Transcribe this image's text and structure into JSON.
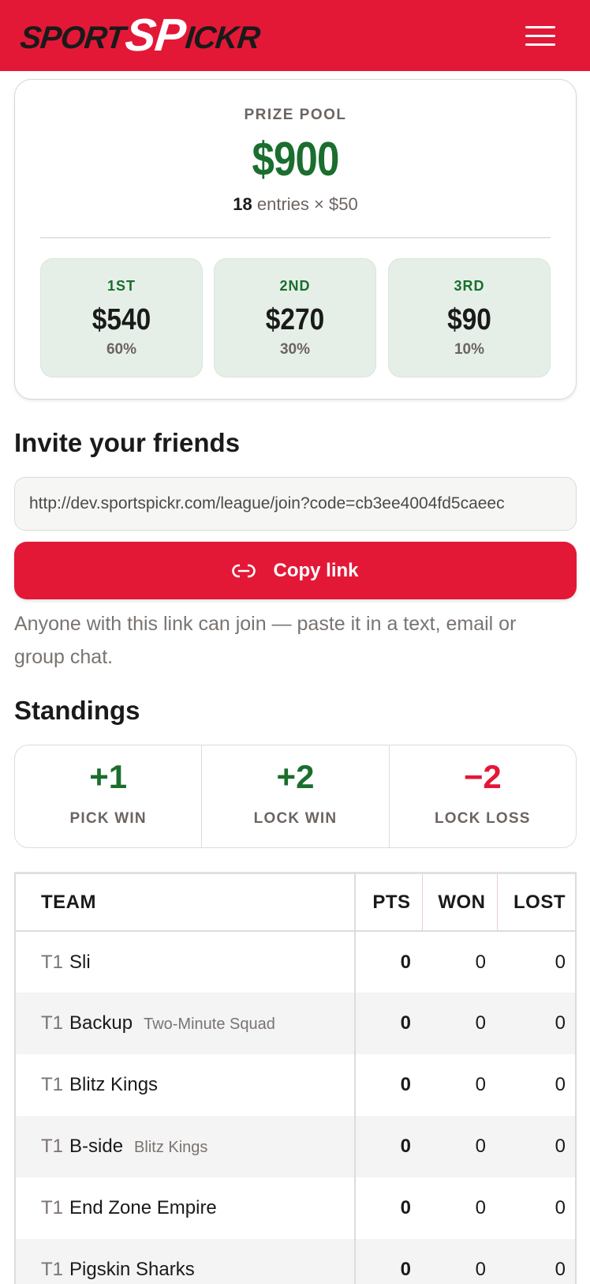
{
  "header": {
    "logo_part1": "SPORT",
    "logo_part2": "SP",
    "logo_part3": "ICKR",
    "menu_icon": "hamburger-menu-icon"
  },
  "prize_pool": {
    "label": "PRIZE POOL",
    "amount": "$900",
    "entries_count": "18",
    "entries_text": " entries × $50",
    "places": [
      {
        "place": "1ST",
        "amount": "$540",
        "percent": "60%"
      },
      {
        "place": "2ND",
        "amount": "$270",
        "percent": "30%"
      },
      {
        "place": "3RD",
        "amount": "$90",
        "percent": "10%"
      }
    ]
  },
  "invite": {
    "title": "Invite your friends",
    "link": "http://dev.sportspickr.com/league/join?code=cb3ee4004fd5caeec",
    "copy_label": "Copy link",
    "copy_icon": "link-icon",
    "help_text": "Anyone with this link can join — paste it in a text, email or group chat."
  },
  "standings": {
    "title": "Standings",
    "scoring": [
      {
        "value": "+1",
        "label": "PICK WIN"
      },
      {
        "value": "+2",
        "label": "LOCK WIN"
      },
      {
        "value": "−2",
        "label": "LOCK LOSS"
      }
    ],
    "columns": {
      "team": "TEAM",
      "pts": "PTS",
      "won": "WON",
      "lost": "LOST"
    },
    "rows": [
      {
        "tier": "T1",
        "name": "Sli",
        "sub": "",
        "pts": "0",
        "won": "0",
        "lost": "0"
      },
      {
        "tier": "T1",
        "name": "Backup",
        "sub": "Two-Minute Squad",
        "pts": "0",
        "won": "0",
        "lost": "0"
      },
      {
        "tier": "T1",
        "name": "Blitz Kings",
        "sub": "",
        "pts": "0",
        "won": "0",
        "lost": "0"
      },
      {
        "tier": "T1",
        "name": "B-side",
        "sub": "Blitz Kings",
        "pts": "0",
        "won": "0",
        "lost": "0"
      },
      {
        "tier": "T1",
        "name": "End Zone Empire",
        "sub": "",
        "pts": "0",
        "won": "0",
        "lost": "0"
      },
      {
        "tier": "T1",
        "name": "Pigskin Sharks",
        "sub": "",
        "pts": "0",
        "won": "0",
        "lost": "0"
      }
    ]
  },
  "colors": {
    "brand_red": "#e31837",
    "positive_green": "#1a6e2e",
    "muted_text": "#6b6460"
  }
}
